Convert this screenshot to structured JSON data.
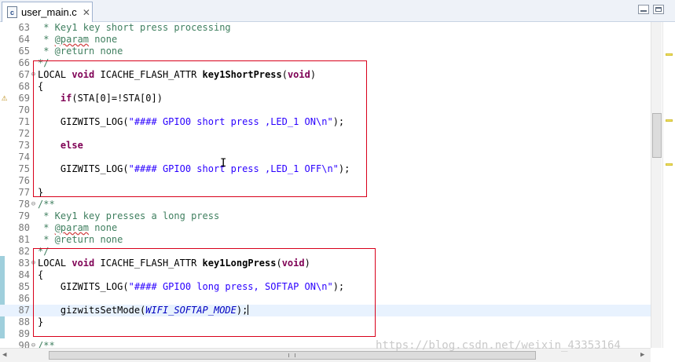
{
  "tab": {
    "icon": "c-file-icon",
    "label": "user_main.c",
    "close": "✕"
  },
  "watermark": "https://blog.csdn.net/weixin_43353164",
  "lines": [
    {
      "n": "63",
      "segs": [
        {
          "c": "cm",
          "t": " * Key1 key short press processing"
        }
      ]
    },
    {
      "n": "64",
      "segs": [
        {
          "c": "cm",
          "t": " * "
        },
        {
          "c": "cm spell",
          "t": "@param"
        },
        {
          "c": "cm",
          "t": " none"
        }
      ]
    },
    {
      "n": "65",
      "segs": [
        {
          "c": "cm",
          "t": " * @return none"
        }
      ]
    },
    {
      "n": "66",
      "segs": [
        {
          "c": "cm",
          "t": "*/"
        }
      ]
    },
    {
      "n": "67",
      "fold": "⊖",
      "segs": [
        {
          "c": "",
          "t": "LOCAL "
        },
        {
          "c": "kw",
          "t": "void"
        },
        {
          "c": "",
          "t": " ICACHE_FLASH_ATTR "
        },
        {
          "c": "fn",
          "t": "key1ShortPress"
        },
        {
          "c": "",
          "t": "("
        },
        {
          "c": "kw",
          "t": "void"
        },
        {
          "c": "",
          "t": ")"
        }
      ]
    },
    {
      "n": "68",
      "segs": [
        {
          "c": "",
          "t": "{"
        }
      ]
    },
    {
      "n": "69",
      "segs": [
        {
          "c": "",
          "t": "    "
        },
        {
          "c": "kw",
          "t": "if"
        },
        {
          "c": "",
          "t": "(STA[0]=!STA[0])"
        }
      ]
    },
    {
      "n": "70",
      "segs": []
    },
    {
      "n": "71",
      "segs": [
        {
          "c": "",
          "t": "    GIZWITS_LOG("
        },
        {
          "c": "str",
          "t": "\"#### GPIO0 short press ,LED_1 ON\\n\""
        },
        {
          "c": "",
          "t": ");"
        }
      ]
    },
    {
      "n": "72",
      "segs": []
    },
    {
      "n": "73",
      "segs": [
        {
          "c": "",
          "t": "    "
        },
        {
          "c": "kw",
          "t": "else"
        }
      ]
    },
    {
      "n": "74",
      "segs": []
    },
    {
      "n": "75",
      "segs": [
        {
          "c": "",
          "t": "    GIZWITS_LOG("
        },
        {
          "c": "str",
          "t": "\"#### GPIO0 short press ,LED_1 OFF\\n\""
        },
        {
          "c": "",
          "t": ");"
        }
      ]
    },
    {
      "n": "76",
      "segs": []
    },
    {
      "n": "77",
      "segs": [
        {
          "c": "",
          "t": "}"
        }
      ]
    },
    {
      "n": "78",
      "fold": "⊖",
      "segs": [
        {
          "c": "cm",
          "t": "/**"
        }
      ]
    },
    {
      "n": "79",
      "segs": [
        {
          "c": "cm",
          "t": " * Key1 key presses a long press"
        }
      ]
    },
    {
      "n": "80",
      "segs": [
        {
          "c": "cm",
          "t": " * "
        },
        {
          "c": "cm spell",
          "t": "@param"
        },
        {
          "c": "cm",
          "t": " none"
        }
      ]
    },
    {
      "n": "81",
      "segs": [
        {
          "c": "cm",
          "t": " * @return none"
        }
      ]
    },
    {
      "n": "82",
      "segs": [
        {
          "c": "cm",
          "t": "*/"
        }
      ]
    },
    {
      "n": "83",
      "fold": "⊖",
      "segs": [
        {
          "c": "",
          "t": "LOCAL "
        },
        {
          "c": "kw",
          "t": "void"
        },
        {
          "c": "",
          "t": " ICACHE_FLASH_ATTR "
        },
        {
          "c": "fn",
          "t": "key1LongPress"
        },
        {
          "c": "",
          "t": "("
        },
        {
          "c": "kw",
          "t": "void"
        },
        {
          "c": "",
          "t": ")"
        }
      ]
    },
    {
      "n": "84",
      "segs": [
        {
          "c": "",
          "t": "{"
        }
      ]
    },
    {
      "n": "85",
      "segs": [
        {
          "c": "",
          "t": "    GIZWITS_LOG("
        },
        {
          "c": "str",
          "t": "\"#### GPIO0 long press, SOFTAP ON\\n\""
        },
        {
          "c": "",
          "t": ");"
        }
      ]
    },
    {
      "n": "86",
      "segs": []
    },
    {
      "n": "87",
      "current": true,
      "caret": true,
      "segs": [
        {
          "c": "",
          "t": "    gizwitsSetMode("
        },
        {
          "c": "it",
          "t": "WIFI_SOFTAP_MODE"
        },
        {
          "c": "",
          "t": ");"
        }
      ]
    },
    {
      "n": "88",
      "segs": [
        {
          "c": "",
          "t": "}"
        }
      ]
    },
    {
      "n": "89",
      "segs": []
    },
    {
      "n": "90",
      "fold": "⊖",
      "segs": [
        {
          "c": "cm",
          "t": "/**"
        }
      ]
    }
  ]
}
